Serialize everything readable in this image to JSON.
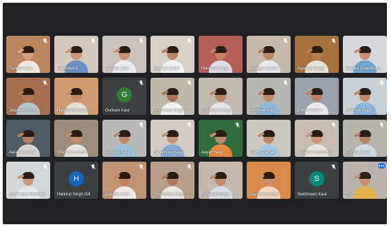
{
  "participants": [
    {
      "name": "Tavleen Kaur",
      "type": "video",
      "muted": true,
      "bg": "#b9865e",
      "skin": "#d2a17f",
      "shirt": "#efe9e0"
    },
    {
      "name": "Pushneet K",
      "type": "video",
      "muted": true,
      "bg": "#d4c8bc",
      "skin": "#c89575",
      "shirt": "#6d8fc5"
    },
    {
      "name": "Drishika Jain",
      "type": "video",
      "muted": true,
      "bg": "#c9c2bd",
      "skin": "#c68f6d",
      "shirt": "#e9edf0"
    },
    {
      "name": "Kunwar Sahib",
      "type": "video",
      "muted": true,
      "bg": "#d8d1c7",
      "skin": "#bd8466",
      "shirt": "#f1f1ef"
    },
    {
      "name": "Manisha Ahuja",
      "type": "video",
      "muted": false,
      "bg": "#b45e58",
      "skin": "#c68465",
      "shirt": "#dedbe7"
    },
    {
      "name": "Bhavya Chiman",
      "type": "video",
      "muted": true,
      "bg": "#c6b9aa",
      "skin": "#ba8662",
      "shirt": "#e8e7ef"
    },
    {
      "name": "Agamjot Singh",
      "type": "video",
      "muted": true,
      "bg": "#a6713d",
      "skin": "#b97c55",
      "shirt": "#e7e2d8"
    },
    {
      "name": "Manika Chaudhary",
      "type": "video",
      "muted": false,
      "bg": "#d7d8de",
      "skin": "#c48f72",
      "shirt": "#70a4cf"
    },
    {
      "name": "Jaspreet Singh",
      "type": "video",
      "muted": true,
      "bg": "#a66f4f",
      "skin": "#b07a57",
      "shirt": "#b8c4cc"
    },
    {
      "name": "Harshdeep Kalsi",
      "type": "video",
      "muted": false,
      "bg": "#cf9c72",
      "skin": "#c1886a",
      "shirt": "#e3ddd2"
    },
    {
      "name": "Gurbani Kaur",
      "type": "avatar",
      "muted": true,
      "initial": "G",
      "avatarColor": "#2e7d32"
    },
    {
      "name": "Bir Pratap Singh",
      "type": "video",
      "muted": true,
      "bg": "#bfb8a8",
      "skin": "#a97458",
      "shirt": "#f2f2f2"
    },
    {
      "name": "Siddhant Nandy",
      "type": "video",
      "muted": false,
      "bg": "#c2b9b1",
      "skin": "#b98464",
      "shirt": "#e3e3e6"
    },
    {
      "name": "Ashmeet Kaur",
      "type": "video",
      "muted": true,
      "bg": "#b8b6b0",
      "skin": "#c1896a",
      "shirt": "#8db6d8"
    },
    {
      "name": "Zubin Kahlon",
      "type": "video",
      "muted": false,
      "bg": "#9aa2ad",
      "skin": "#b98166",
      "shirt": "#e6e8ea"
    },
    {
      "name": "Ekamjot Singh",
      "type": "video",
      "muted": true,
      "bg": "#c9d0d6",
      "skin": "#bf8c70",
      "shirt": "#8ab7e0"
    },
    {
      "name": "Aarav Kaushal",
      "type": "video",
      "muted": false,
      "bg": "#4f5b66",
      "skin": "#b48064",
      "shirt": "#d6d3d0"
    },
    {
      "name": "Shivansh Kumar",
      "type": "video",
      "muted": false,
      "bg": "#9f8d7c",
      "skin": "#c4906f",
      "shirt": "#e8e5e0"
    },
    {
      "name": "Ashbani Kaur",
      "type": "video",
      "muted": true,
      "bg": "#b8b9ba",
      "skin": "#c08a6c",
      "shirt": "#9bc1dc"
    },
    {
      "name": "Harsimran Kaur",
      "type": "video",
      "muted": true,
      "bg": "#d3cbc4",
      "skin": "#c59275",
      "shirt": "#86aad1"
    },
    {
      "name": "Aayan Negi",
      "type": "video",
      "muted": true,
      "bg": "#2f6e3c",
      "skin": "#c28a6a",
      "shirt": "#e38a3a"
    },
    {
      "name": "Nainsi Pathak",
      "type": "video",
      "muted": false,
      "bg": "#cdc8bf",
      "skin": "#be8969",
      "shirt": "#a3c6e0"
    },
    {
      "name": "Angelina Vashisht",
      "type": "video",
      "muted": true,
      "bg": "#c7bdb0",
      "skin": "#c99477",
      "shirt": "#e9e4dc"
    },
    {
      "name": "Gurkirat Kaur",
      "type": "video",
      "muted": true,
      "bg": "#b7b3ad",
      "skin": "#b98466",
      "shirt": "#d1dae2"
    },
    {
      "name": "Sidak Kaur Dhaliwal",
      "type": "video",
      "muted": true,
      "bg": "#d1d6db",
      "skin": "#c99777",
      "shirt": "#e3e7ec"
    },
    {
      "name": "Harkirat Singh Gill",
      "type": "avatar",
      "muted": true,
      "initial": "H",
      "avatarColor": "#1565c0"
    },
    {
      "name": "Ashmita Kaur",
      "type": "video",
      "muted": true,
      "bg": "#c29476",
      "skin": "#bf8364",
      "shirt": "#ede9e5"
    },
    {
      "name": "ShivPartap Singh",
      "type": "video",
      "muted": true,
      "bg": "#b79f8a",
      "skin": "#b27b5c",
      "shirt": "#ebe6df"
    },
    {
      "name": "Rehatpal Singh",
      "type": "video",
      "muted": false,
      "bg": "#c5b7ac",
      "skin": "#c28c6d",
      "shirt": "#d9dee4"
    },
    {
      "name": "Manpreet Singh",
      "type": "video",
      "muted": false,
      "bg": "#d88a49",
      "skin": "#c48d6d",
      "shirt": "#f0d7c0"
    },
    {
      "name": "Sukhmeen Kaur",
      "type": "avatar",
      "muted": true,
      "initial": "S",
      "avatarColor": "#00897b"
    },
    {
      "name": "You",
      "type": "video",
      "muted": false,
      "self": true,
      "bg": "#b9b3ab",
      "skin": "#c58f70",
      "shirt": "#e2b24a"
    }
  ]
}
